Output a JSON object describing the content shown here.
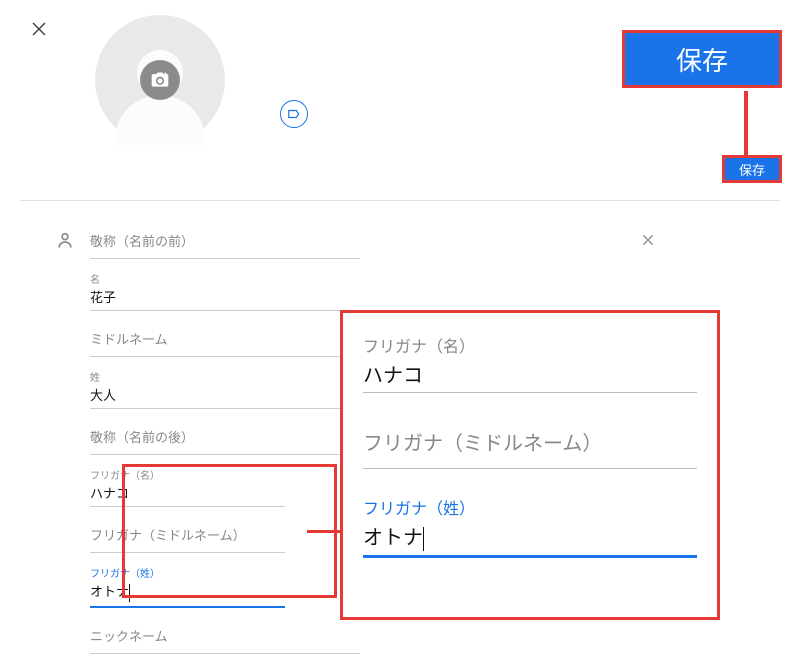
{
  "buttons": {
    "save": "保存",
    "save_small": "保存"
  },
  "fields": {
    "honorific_prefix": {
      "label": "敬称（名前の前）"
    },
    "first_name": {
      "label": "名",
      "value": "花子"
    },
    "middle_name": {
      "label": "ミドルネーム"
    },
    "last_name": {
      "label": "姓",
      "value": "大人"
    },
    "honorific_suffix": {
      "label": "敬称（名前の後）"
    },
    "phonetic_first": {
      "label": "フリガナ（名）",
      "value": "ハナコ"
    },
    "phonetic_middle": {
      "label": "フリガナ（ミドルネーム）"
    },
    "phonetic_last": {
      "label": "フリガナ（姓）",
      "value": "オトナ"
    },
    "nickname": {
      "label": "ニックネーム"
    }
  },
  "zoom": {
    "phonetic_first": {
      "label": "フリガナ（名）",
      "value": "ハナコ"
    },
    "phonetic_middle": {
      "label": "フリガナ（ミドルネーム）"
    },
    "phonetic_last": {
      "label": "フリガナ（姓）",
      "value": "オトナ"
    }
  }
}
